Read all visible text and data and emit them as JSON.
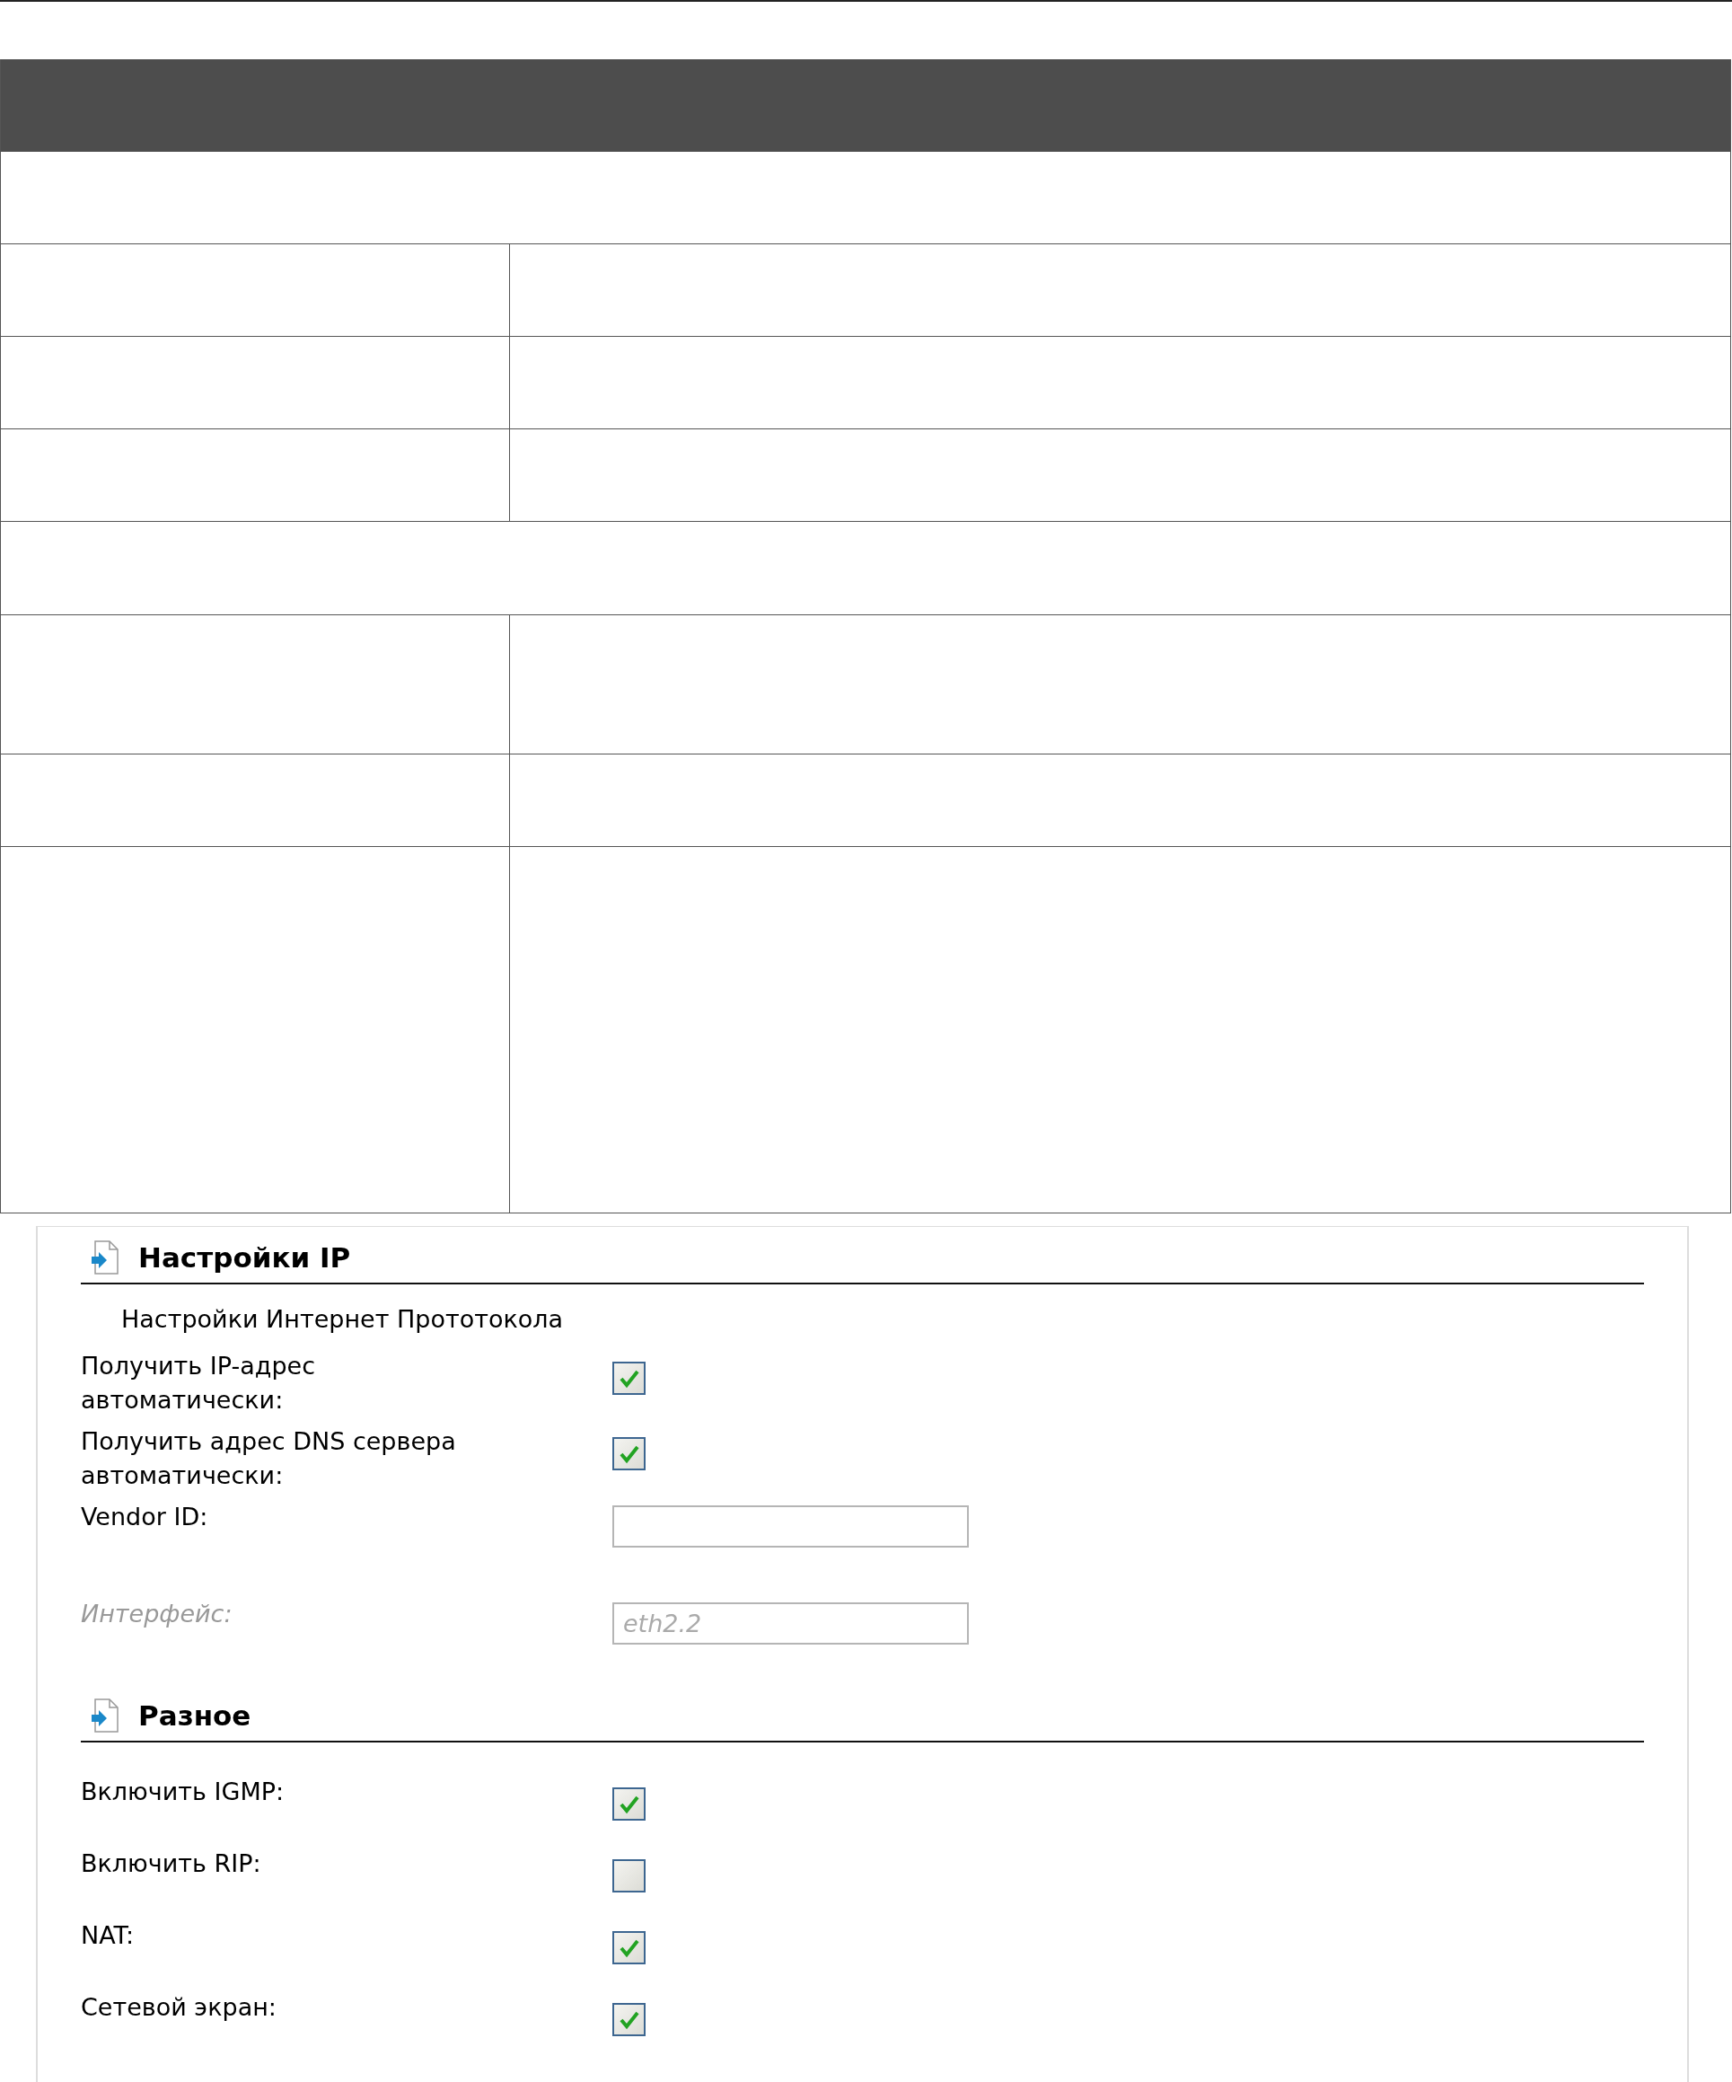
{
  "sections": [
    {
      "title": "Настройки IP",
      "subtitle": "Настройки Интернет Прототокола",
      "fields": [
        {
          "kind": "checkbox",
          "label": "Получить IP-адрес автоматически:",
          "checked": true,
          "disabled": false
        },
        {
          "kind": "checkbox",
          "label": "Получить адрес DNS сервера автоматически:",
          "checked": true,
          "disabled": false
        },
        {
          "kind": "text",
          "label": "Vendor ID:",
          "disabled": false
        },
        {
          "kind": "text",
          "label": "Интерфейс:",
          "value": "eth2.2",
          "disabled": true
        }
      ]
    },
    {
      "title": "Разное",
      "fields": [
        {
          "kind": "checkbox",
          "label": "Включить IGMP:",
          "checked": true,
          "disabled": false
        },
        {
          "kind": "checkbox",
          "label": "Включить RIP:",
          "checked": false,
          "disabled": false
        },
        {
          "kind": "checkbox",
          "label": "NAT:",
          "checked": true,
          "disabled": false
        },
        {
          "kind": "checkbox",
          "label": "Сетевой экран:",
          "checked": true,
          "disabled": false
        }
      ]
    }
  ]
}
